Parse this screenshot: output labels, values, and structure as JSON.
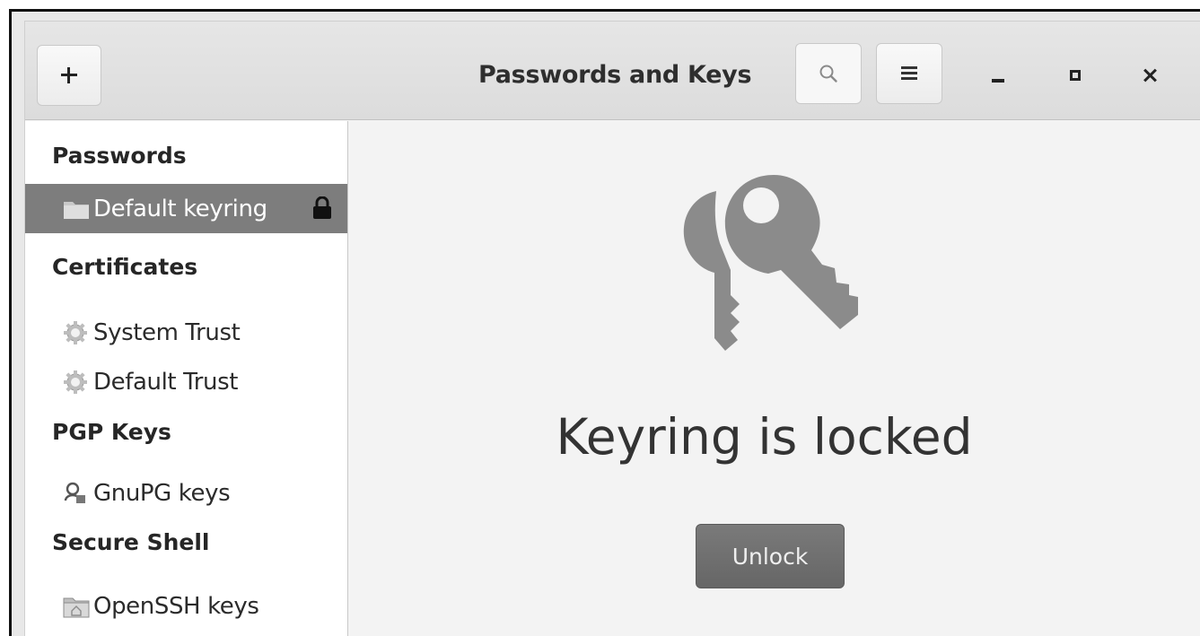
{
  "window": {
    "title": "Passwords and Keys"
  },
  "sidebar": {
    "sections": [
      {
        "heading": "Passwords"
      },
      {
        "heading": "Certificates"
      },
      {
        "heading": "PGP Keys"
      },
      {
        "heading": "Secure Shell"
      }
    ],
    "items": [
      {
        "label": "Default keyring",
        "icon": "folder-icon",
        "selected": true,
        "locked": true
      },
      {
        "label": "System Trust",
        "icon": "gear-icon"
      },
      {
        "label": "Default Trust",
        "icon": "gear-icon"
      },
      {
        "label": "GnuPG keys",
        "icon": "key-person-icon"
      },
      {
        "label": "OpenSSH keys",
        "icon": "folder-home-icon"
      }
    ]
  },
  "main": {
    "status": "Keyring is locked",
    "unlock_label": "Unlock"
  },
  "colors": {
    "selected_row": "#7d7d7d",
    "unlock_button": "#6e6e6e",
    "keys_graphic": "#8a8a8a"
  }
}
